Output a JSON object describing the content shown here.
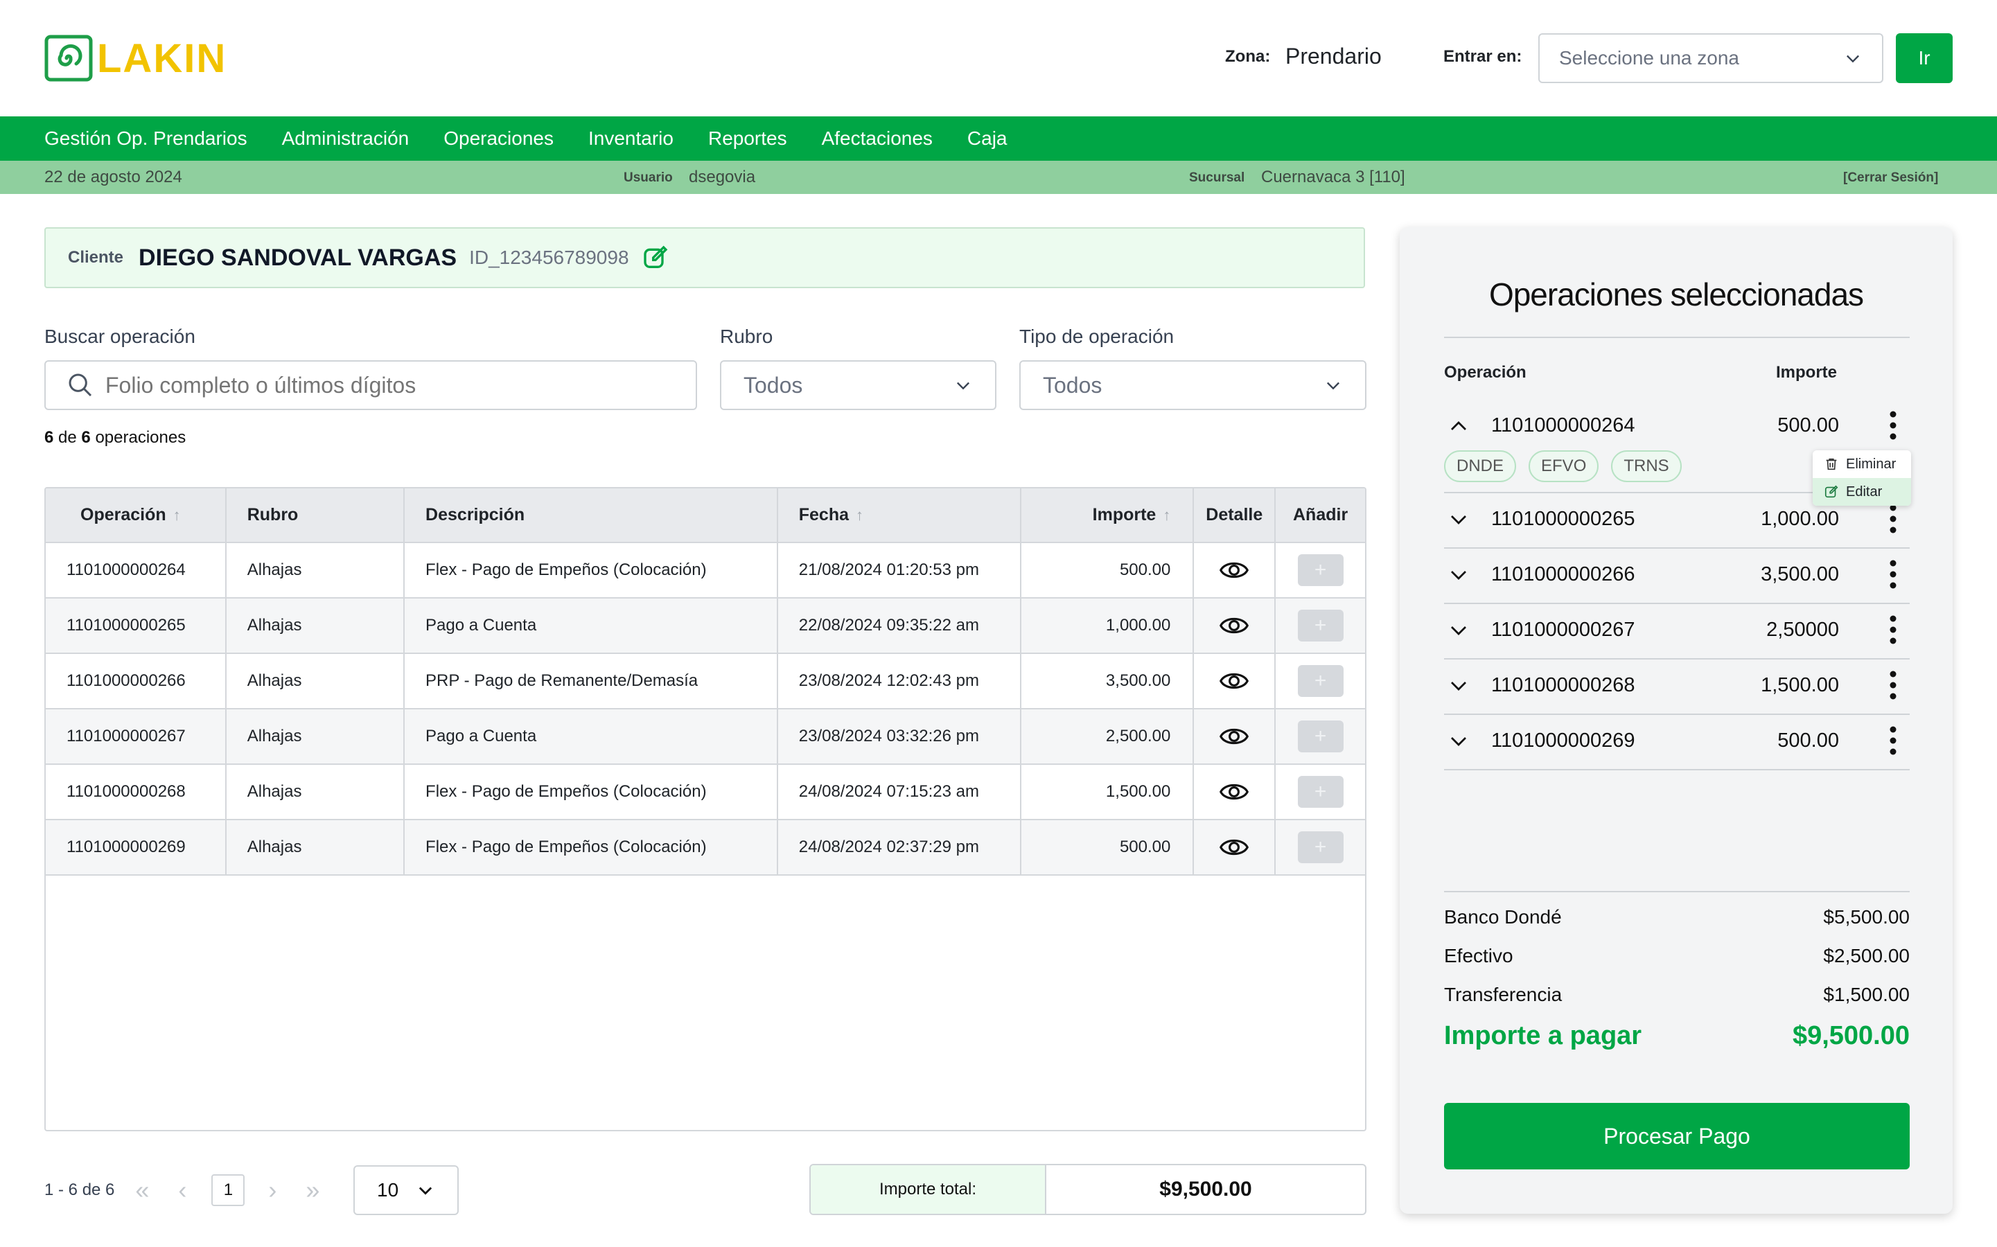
{
  "brand": {
    "name": "LAKIN"
  },
  "colors": {
    "primary": "#00a645",
    "subbar": "#8fcf9e",
    "logo_text": "#f2c300"
  },
  "header": {
    "zona_label": "Zona:",
    "zona_value": "Prendario",
    "entrar_label": "Entrar en:",
    "zona_select_placeholder": "Seleccione una zona",
    "go_label": "Ir"
  },
  "nav": {
    "items": [
      "Gestión Op. Prendarios",
      "Administración",
      "Operaciones",
      "Inventario",
      "Reportes",
      "Afectaciones",
      "Caja"
    ]
  },
  "info": {
    "date": "22 de agosto 2024",
    "usuario_label": "Usuario",
    "usuario_value": "dsegovia",
    "sucursal_label": "Sucursal",
    "sucursal_value": "Cuernavaca 3 [110]",
    "logout": "[Cerrar Sesión]"
  },
  "client": {
    "label": "Cliente",
    "name": "DIEGO SANDOVAL VARGAS",
    "id": "ID_123456789098",
    "edit_icon": "edit-icon"
  },
  "filters": {
    "search_label": "Buscar operación",
    "search_placeholder": "Folio completo o últimos dígitos",
    "rubro_label": "Rubro",
    "rubro_value": "Todos",
    "tipo_label": "Tipo de operación",
    "tipo_value": "Todos"
  },
  "count": {
    "shown": "6",
    "de": "de",
    "total": "6",
    "suffix": "operaciones"
  },
  "table": {
    "headers": [
      "Operación",
      "Rubro",
      "Descripción",
      "Fecha",
      "Importe",
      "Detalle",
      "Añadir"
    ],
    "rows": [
      {
        "op": "1101000000264",
        "rubro": "Alhajas",
        "desc": "Flex - Pago de Empeños (Colocación)",
        "fecha": "21/08/2024 01:20:53 pm",
        "importe": "500.00"
      },
      {
        "op": "1101000000265",
        "rubro": "Alhajas",
        "desc": "Pago a Cuenta",
        "fecha": "22/08/2024 09:35:22 am",
        "importe": "1,000.00"
      },
      {
        "op": "1101000000266",
        "rubro": "Alhajas",
        "desc": "PRP - Pago de Remanente/Demasía",
        "fecha": "23/08/2024 12:02:43 pm",
        "importe": "3,500.00"
      },
      {
        "op": "1101000000267",
        "rubro": "Alhajas",
        "desc": "Pago a Cuenta",
        "fecha": "23/08/2024 03:32:26 pm",
        "importe": "2,500.00"
      },
      {
        "op": "1101000000268",
        "rubro": "Alhajas",
        "desc": "Flex - Pago de Empeños (Colocación)",
        "fecha": "24/08/2024 07:15:23 am",
        "importe": "1,500.00"
      },
      {
        "op": "1101000000269",
        "rubro": "Alhajas",
        "desc": "Flex - Pago de Empeños (Colocación)",
        "fecha": "24/08/2024 02:37:29 pm",
        "importe": "500.00"
      }
    ],
    "add_symbol": "+"
  },
  "pagination": {
    "range": "1 - 6 de 6",
    "first": "«",
    "prev": "‹",
    "current": "1",
    "next": "›",
    "last": "»",
    "per_page": "10"
  },
  "total": {
    "label": "Importe total:",
    "value": "$9,500.00"
  },
  "panel": {
    "title": "Operaciones seleccionadas",
    "col_op": "Operación",
    "col_importe": "Importe",
    "ops": [
      {
        "num": "1101000000264",
        "amt": "500.00",
        "expanded": true
      },
      {
        "num": "1101000000265",
        "amt": "1,000.00",
        "expanded": false
      },
      {
        "num": "1101000000266",
        "amt": "3,500.00",
        "expanded": false
      },
      {
        "num": "1101000000267",
        "amt": "2,50000",
        "expanded": false
      },
      {
        "num": "1101000000268",
        "amt": "1,500.00",
        "expanded": false
      },
      {
        "num": "1101000000269",
        "amt": "500.00",
        "expanded": false
      }
    ],
    "tags": [
      "DNDE",
      "EFVO",
      "TRNS"
    ],
    "menu": {
      "delete": "Eliminar",
      "edit": "Editar"
    },
    "summary": [
      {
        "label": "Banco Dondé",
        "value": "$5,500.00"
      },
      {
        "label": "Efectivo",
        "value": "$2,500.00"
      },
      {
        "label": "Transferencia",
        "value": "$1,500.00"
      }
    ],
    "grand_label": "Importe a pagar",
    "grand_value": "$9,500.00",
    "process_label": "Procesar Pago"
  }
}
